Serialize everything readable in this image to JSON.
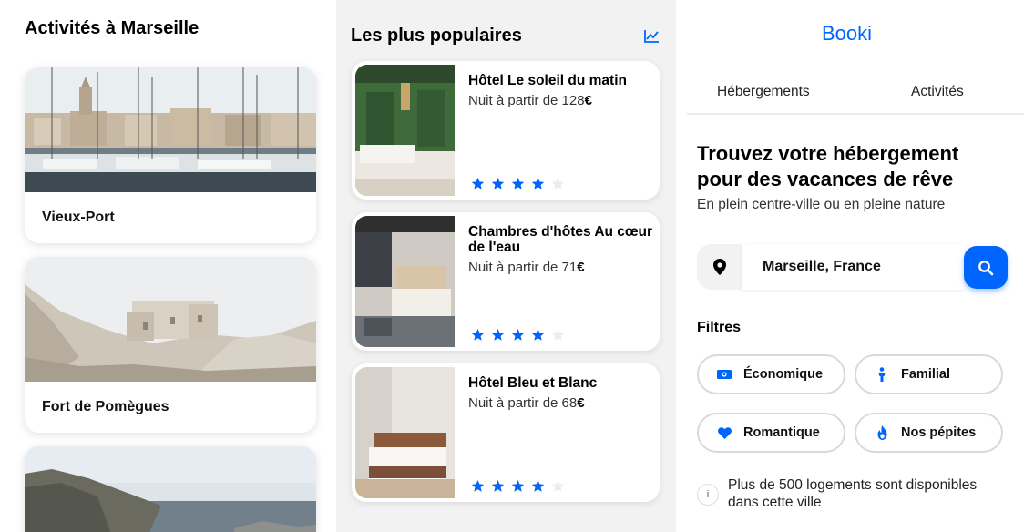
{
  "colors": {
    "accent": "#0065fc",
    "chip_border": "#d9d9d9",
    "mid_bg": "#f2f2f2"
  },
  "activities": {
    "title": "Activités à Marseille",
    "items": [
      {
        "label": "Vieux-Port",
        "image": "harbor-photo"
      },
      {
        "label": "Fort de Pomègues",
        "image": "fort-photo"
      },
      {
        "label": "",
        "image": "calanques-photo"
      }
    ]
  },
  "popular": {
    "title": "Les plus populaires",
    "icon": "trend-chart-icon",
    "hotels": [
      {
        "name": "Hôtel Le soleil du matin",
        "price_prefix": "Nuit à partir de 128",
        "currency": "€",
        "rating": 4,
        "max_rating": 5
      },
      {
        "name": "Chambres d'hôtes Au cœur de l'eau",
        "price_prefix": "Nuit à partir de 71",
        "currency": "€",
        "rating": 4,
        "max_rating": 5
      },
      {
        "name": "Hôtel Bleu et Blanc",
        "price_prefix": "Nuit à partir de 68",
        "currency": "€",
        "rating": 4,
        "max_rating": 5
      }
    ]
  },
  "booki": {
    "logo": "Booki",
    "tabs": [
      {
        "label": "Hébergements"
      },
      {
        "label": "Activités"
      }
    ],
    "hero_title": "Trouvez votre hébergement pour des vacances de rêve",
    "hero_subtitle": "En plein centre-ville ou en pleine nature",
    "search": {
      "value": "Marseille, France",
      "pin_icon": "location-pin-icon",
      "button_icon": "search-icon"
    },
    "filters_label": "Filtres",
    "filters": [
      {
        "label": "Économique",
        "icon": "money-icon"
      },
      {
        "label": "Familial",
        "icon": "person-icon"
      },
      {
        "label": "Romantique",
        "icon": "heart-icon"
      },
      {
        "label": "Nos pépites",
        "icon": "fire-icon"
      }
    ],
    "info_text": "Plus de 500 logements sont disponibles dans cette ville",
    "info_icon_glyph": "i"
  }
}
